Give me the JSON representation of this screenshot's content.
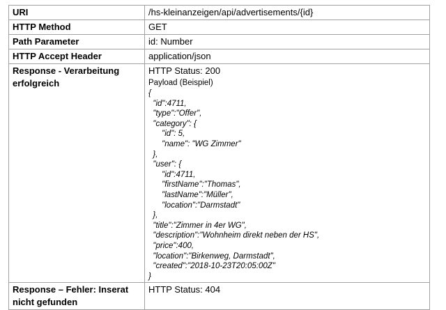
{
  "rows": [
    {
      "key": "URI",
      "value": "/hs-kleinanzeigen/api/advertisements/{id}"
    },
    {
      "key": "HTTP Method",
      "value": "GET"
    },
    {
      "key": "Path Parameter",
      "value": "id: Number"
    },
    {
      "key": "HTTP Accept Header",
      "value": "application/json"
    }
  ],
  "success": {
    "key_line1": "Response - Verarbeitung",
    "key_line2": "erfolgreich",
    "status": "HTTP Status: 200",
    "payload_label": "Payload (Beispiel)",
    "code_lines": [
      "{",
      "  \"id\":4711,",
      "  \"type\":\"Offer\",",
      "  \"category\": {",
      "      \"id\": 5,",
      "      \"name\": \"WG Zimmer\"",
      "  },",
      "  \"user\": {",
      "      \"id\":4711,",
      "      \"firstName\":\"Thomas\",",
      "      \"lastName\":\"Müller\",",
      "      \"location\":\"Darmstadt\"",
      "  },",
      "  \"title\":\"Zimmer in 4er WG\",",
      "  \"description\":\"Wohnheim direkt neben der HS\",",
      "  \"price\":400,",
      "  \"location\":\"Birkenweg, Darmstadt\",",
      "  \"created\":\"2018-10-23T20:05:00Z\"",
      "}"
    ]
  },
  "error": {
    "key_line1": "Response – Fehler: Inserat",
    "key_line2": "nicht gefunden",
    "status": "HTTP Status: 404"
  }
}
